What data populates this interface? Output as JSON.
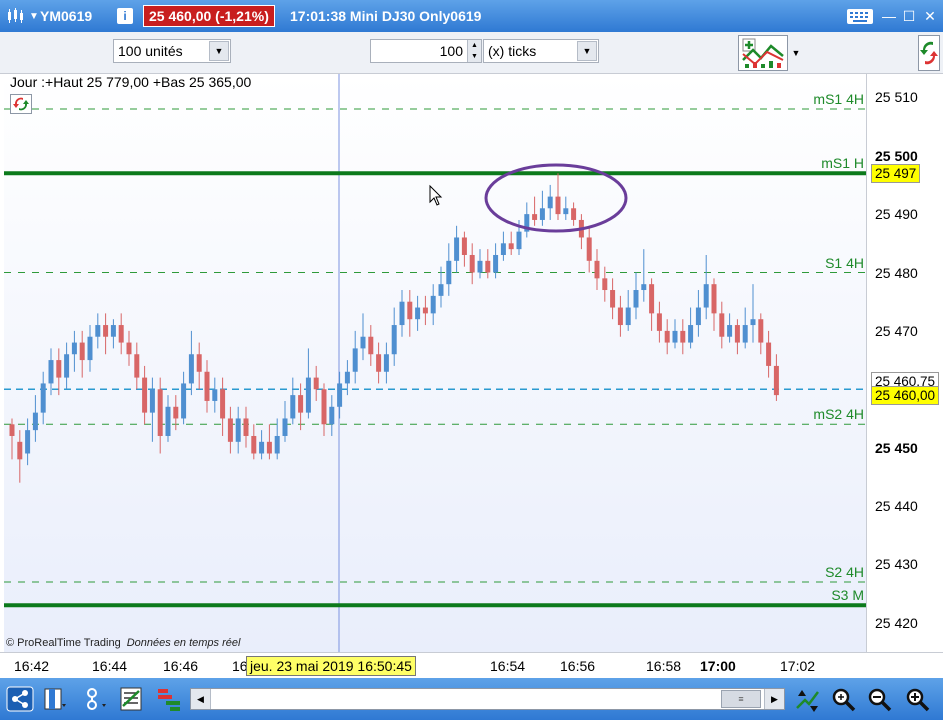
{
  "window": {
    "symbol": "YM0619",
    "price_badge": "25 460,00 (-1,21%)",
    "description": "17:01:38 Mini DJ30 Only0619",
    "info_icon": "info-icon"
  },
  "toolbar": {
    "quantity_combo": "100 unités",
    "ticks_value": "100",
    "ticks_unit_combo": "(x) ticks"
  },
  "chart_header": {
    "info_line": "Jour :+Haut 25 779,00 +Bas 25 365,00"
  },
  "footer": {
    "copyright": "© ProRealTime Trading",
    "realtime": "Données en temps réel"
  },
  "cursor": {
    "date_label": "jeu. 23 mai 2019 16:50:45"
  },
  "colors": {
    "up": "#4f8fd0",
    "down": "#d86666",
    "level": "#1e8a2a",
    "dashed_last": "#2a9ad0",
    "highlight_ellipse": "#6a3d9a",
    "price_tag": "#ffff00"
  },
  "chart_data": {
    "type": "candlestick",
    "ylim": [
      25415,
      25514
    ],
    "yticks": [
      {
        "value": 25510,
        "label": "25 510",
        "bold": false
      },
      {
        "value": 25500,
        "label": "25 500",
        "bold": true
      },
      {
        "value": 25490,
        "label": "25 490",
        "bold": false
      },
      {
        "value": 25480,
        "label": "25 480",
        "bold": false
      },
      {
        "value": 25470,
        "label": "25 470",
        "bold": false
      },
      {
        "value": 25450,
        "label": "25 450",
        "bold": true
      },
      {
        "value": 25440,
        "label": "25 440",
        "bold": false
      },
      {
        "value": 25430,
        "label": "25 430",
        "bold": false
      },
      {
        "value": 25420,
        "label": "25 420",
        "bold": false
      }
    ],
    "xticks": [
      {
        "label": "16:42",
        "bold": false
      },
      {
        "label": "16:44",
        "bold": false
      },
      {
        "label": "16:46",
        "bold": false
      },
      {
        "label": "16",
        "bold": false
      },
      {
        "label": "16:54",
        "bold": false
      },
      {
        "label": "16:56",
        "bold": false
      },
      {
        "label": "16:58",
        "bold": false
      },
      {
        "label": "17:00",
        "bold": true
      },
      {
        "label": "17:02",
        "bold": false
      }
    ],
    "levels": [
      {
        "name": "mS1 4H",
        "value": 25508,
        "style": "dashed"
      },
      {
        "name": "mS1 H",
        "value": 25497,
        "style": "solid"
      },
      {
        "name": "S1 4H",
        "value": 25480,
        "style": "dashed"
      },
      {
        "name": "mS2 4H",
        "value": 25454,
        "style": "dashed"
      },
      {
        "name": "S2 4H",
        "value": 25427,
        "style": "dashed"
      },
      {
        "name": "S3 M",
        "value": 25423,
        "style": "solid"
      }
    ],
    "last_price_line": 25460,
    "price_tags": [
      {
        "label": "25 497",
        "value": 25497,
        "style": "yellow"
      },
      {
        "label": "25 460,75",
        "value": 25461.5,
        "style": "white"
      },
      {
        "label": "25 460,00",
        "value": 25459,
        "style": "yellow"
      }
    ],
    "candles": [
      [
        25454,
        25452,
        25455,
        25448
      ],
      [
        25451,
        25448,
        25453,
        25444
      ],
      [
        25449,
        25453,
        25455,
        25447
      ],
      [
        25453,
        25456,
        25459,
        25451
      ],
      [
        25456,
        25461,
        25463,
        25454
      ],
      [
        25461,
        25465,
        25467,
        25459
      ],
      [
        25465,
        25462,
        25467,
        25459
      ],
      [
        25462,
        25466,
        25468,
        25460
      ],
      [
        25466,
        25468,
        25470,
        25463
      ],
      [
        25468,
        25465,
        25470,
        25462
      ],
      [
        25465,
        25469,
        25471,
        25463
      ],
      [
        25469,
        25471,
        25473,
        25467
      ],
      [
        25471,
        25469,
        25473,
        25466
      ],
      [
        25469,
        25471,
        25472,
        25467
      ],
      [
        25471,
        25468,
        25473,
        25466
      ],
      [
        25468,
        25466,
        25470,
        25464
      ],
      [
        25466,
        25462,
        25468,
        25460
      ],
      [
        25462,
        25456,
        25464,
        25454
      ],
      [
        25456,
        25460,
        25462,
        25451
      ],
      [
        25460,
        25452,
        25462,
        25449
      ],
      [
        25452,
        25457,
        25459,
        25451
      ],
      [
        25457,
        25455,
        25459,
        25453
      ],
      [
        25455,
        25461,
        25463,
        25454
      ],
      [
        25461,
        25466,
        25470,
        25459
      ],
      [
        25466,
        25463,
        25468,
        25460
      ],
      [
        25463,
        25458,
        25465,
        25456
      ],
      [
        25458,
        25460,
        25462,
        25456
      ],
      [
        25460,
        25455,
        25462,
        25452
      ],
      [
        25455,
        25451,
        25457,
        25449
      ],
      [
        25451,
        25455,
        25457,
        25449
      ],
      [
        25455,
        25452,
        25457,
        25450
      ],
      [
        25452,
        25449,
        25454,
        25448
      ],
      [
        25449,
        25451,
        25453,
        25448
      ],
      [
        25451,
        25449,
        25454,
        25448
      ],
      [
        25449,
        25452,
        25455,
        25448
      ],
      [
        25452,
        25455,
        25458,
        25451
      ],
      [
        25455,
        25459,
        25462,
        25454
      ],
      [
        25459,
        25456,
        25461,
        25453
      ],
      [
        25456,
        25462,
        25467,
        25455
      ],
      [
        25462,
        25460,
        25464,
        25458
      ],
      [
        25460,
        25454,
        25461,
        25452
      ],
      [
        25454,
        25457,
        25459,
        25452
      ],
      [
        25457,
        25461,
        25463,
        25455
      ],
      [
        25461,
        25463,
        25465,
        25459
      ],
      [
        25463,
        25467,
        25470,
        25461
      ],
      [
        25467,
        25469,
        25473,
        25465
      ],
      [
        25469,
        25466,
        25471,
        25464
      ],
      [
        25466,
        25463,
        25468,
        25461
      ],
      [
        25463,
        25466,
        25468,
        25461
      ],
      [
        25466,
        25471,
        25474,
        25464
      ],
      [
        25471,
        25475,
        25477,
        25469
      ],
      [
        25475,
        25472,
        25477,
        25469
      ],
      [
        25472,
        25474,
        25476,
        25470
      ],
      [
        25474,
        25473,
        25476,
        25471
      ],
      [
        25473,
        25476,
        25478,
        25471
      ],
      [
        25476,
        25478,
        25481,
        25474
      ],
      [
        25478,
        25482,
        25485,
        25476
      ],
      [
        25482,
        25486,
        25488,
        25480
      ],
      [
        25486,
        25483,
        25487,
        25481
      ],
      [
        25483,
        25480,
        25485,
        25478
      ],
      [
        25480,
        25482,
        25484,
        25479
      ],
      [
        25482,
        25480,
        25484,
        25479
      ],
      [
        25480,
        25483,
        25485,
        25479
      ],
      [
        25483,
        25485,
        25487,
        25482
      ],
      [
        25485,
        25484,
        25487,
        25483
      ],
      [
        25484,
        25487,
        25489,
        25483
      ],
      [
        25487,
        25490,
        25492,
        25486
      ],
      [
        25490,
        25489,
        25493,
        25488
      ],
      [
        25489,
        25491,
        25494,
        25488
      ],
      [
        25491,
        25493,
        25495,
        25489
      ],
      [
        25493,
        25490,
        25497,
        25489
      ],
      [
        25490,
        25491,
        25493,
        25489
      ],
      [
        25491,
        25489,
        25492,
        25488
      ],
      [
        25489,
        25486,
        25490,
        25484
      ],
      [
        25486,
        25482,
        25488,
        25480
      ],
      [
        25482,
        25479,
        25484,
        25477
      ],
      [
        25479,
        25477,
        25481,
        25475
      ],
      [
        25477,
        25474,
        25479,
        25472
      ],
      [
        25474,
        25471,
        25476,
        25469
      ],
      [
        25471,
        25474,
        25477,
        25470
      ],
      [
        25474,
        25477,
        25480,
        25472
      ],
      [
        25477,
        25478,
        25484,
        25475
      ],
      [
        25478,
        25473,
        25479,
        25470
      ],
      [
        25473,
        25470,
        25475,
        25468
      ],
      [
        25470,
        25468,
        25472,
        25466
      ],
      [
        25468,
        25470,
        25472,
        25467
      ],
      [
        25470,
        25468,
        25472,
        25466
      ],
      [
        25468,
        25471,
        25474,
        25467
      ],
      [
        25471,
        25474,
        25477,
        25469
      ],
      [
        25474,
        25478,
        25483,
        25472
      ],
      [
        25478,
        25473,
        25479,
        25470
      ],
      [
        25473,
        25469,
        25475,
        25467
      ],
      [
        25469,
        25471,
        25473,
        25468
      ],
      [
        25471,
        25468,
        25472,
        25466
      ],
      [
        25468,
        25471,
        25474,
        25467
      ],
      [
        25471,
        25472,
        25478,
        25468
      ],
      [
        25472,
        25468,
        25473,
        25466
      ],
      [
        25468,
        25464,
        25470,
        25462
      ],
      [
        25464,
        25459,
        25466,
        25458
      ]
    ]
  }
}
